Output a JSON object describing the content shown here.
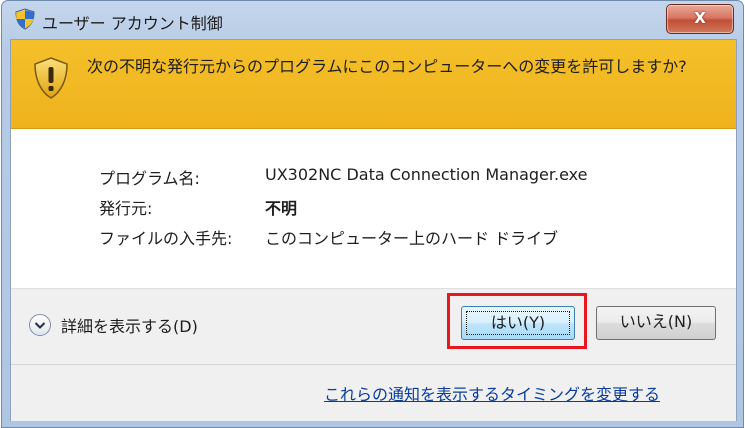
{
  "window": {
    "title": "ユーザー アカウント制御",
    "close_label": "X"
  },
  "banner": {
    "message": "次の不明な発行元からのプログラムにこのコンピューターへの変更を許可しますか?"
  },
  "info": {
    "program_label": "プログラム名:",
    "program_value": "UX302NC Data Connection Manager.exe",
    "publisher_label": "発行元:",
    "publisher_value": "不明",
    "origin_label": "ファイルの入手先:",
    "origin_value": "このコンピューター上のハード ドライブ"
  },
  "actions": {
    "details_label": "詳細を表示する(D)",
    "yes_label": "はい(Y)",
    "no_label": "いいえ(N)"
  },
  "footer": {
    "link_text": "これらの通知を表示するタイミングを変更する"
  },
  "colors": {
    "banner": "#f1b61f",
    "highlight": "#e8161e",
    "link": "#0a3c9e",
    "title_bar": "#b7cbe6",
    "close_button": "#c24f36"
  },
  "icons": {
    "title": "uac-shield-icon",
    "banner": "warning-shield-icon",
    "details": "chevron-down-icon"
  }
}
